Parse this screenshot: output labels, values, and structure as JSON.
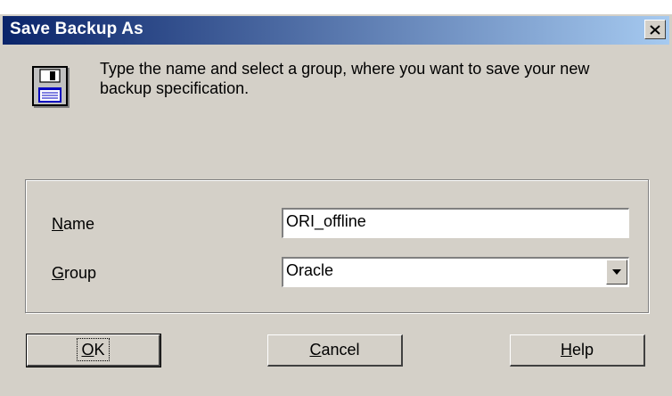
{
  "dialog": {
    "title": "Save Backup As",
    "description": "Type the name and select a group, where you want to save your new backup specification."
  },
  "form": {
    "name": {
      "label_mnemonic": "N",
      "label_rest": "ame",
      "value": "ORI_offline"
    },
    "group": {
      "label_mnemonic": "G",
      "label_rest": "roup",
      "selected": "Oracle"
    }
  },
  "buttons": {
    "ok": {
      "mnemonic": "O",
      "rest": "K"
    },
    "cancel": {
      "mnemonic": "C",
      "rest": "ancel"
    },
    "help": {
      "mnemonic": "H",
      "rest": "elp"
    }
  },
  "icons": {
    "floppy": "floppy-disk-icon",
    "close": "close-icon",
    "dropdown": "chevron-down-icon"
  }
}
